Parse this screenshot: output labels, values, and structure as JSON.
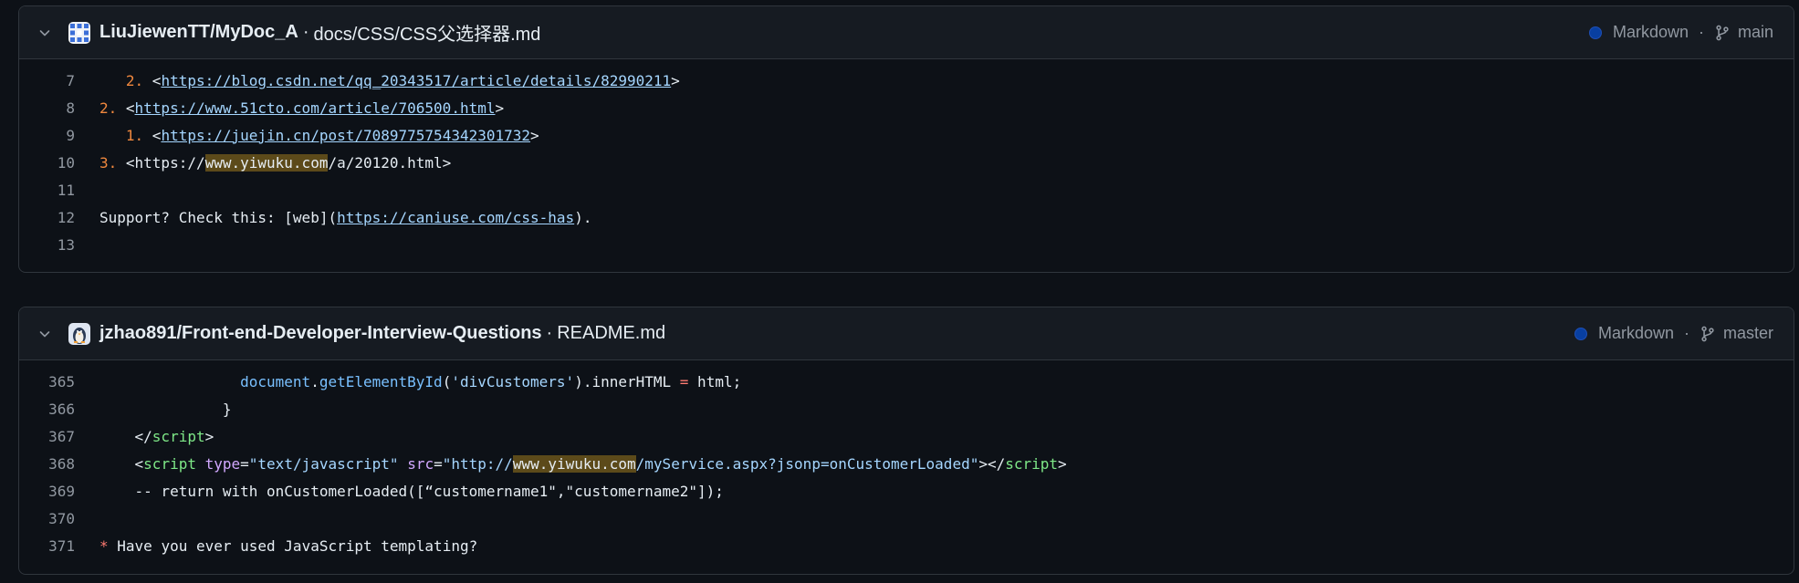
{
  "results": [
    {
      "repo": "LiuJiewenTT/MyDoc_A",
      "separator": "·",
      "path": "docs/CSS/CSS父选择器.md",
      "language": "Markdown",
      "meta_separator": "·",
      "branch": "main",
      "lines": [
        {
          "num": "7",
          "segments": [
            {
              "text": "   "
            },
            {
              "text": "2.",
              "style": "lm"
            },
            {
              "text": " <"
            },
            {
              "text": "https://blog.csdn.net/qq_20343517/article/details/82990211",
              "style": "u"
            },
            {
              "text": ">"
            }
          ]
        },
        {
          "num": "8",
          "segments": [
            {
              "text": "2.",
              "style": "lm"
            },
            {
              "text": " <"
            },
            {
              "text": "https://www.51cto.com/article/706500.html",
              "style": "u"
            },
            {
              "text": ">"
            }
          ]
        },
        {
          "num": "9",
          "segments": [
            {
              "text": "   "
            },
            {
              "text": "1.",
              "style": "lm"
            },
            {
              "text": " <"
            },
            {
              "text": "https://juejin.cn/post/7089775754342301732",
              "style": "u"
            },
            {
              "text": ">"
            }
          ]
        },
        {
          "num": "10",
          "segments": [
            {
              "text": "3.",
              "style": "lm"
            },
            {
              "text": " <https://"
            },
            {
              "text": "www.yiwuku.com",
              "style": "hl"
            },
            {
              "text": "/a/20120.html>"
            }
          ]
        },
        {
          "num": "11",
          "segments": []
        },
        {
          "num": "12",
          "segments": [
            {
              "text": "Support? Check this: [web]("
            },
            {
              "text": "https://caniuse.com/css-has",
              "style": "u"
            },
            {
              "text": ")."
            }
          ]
        },
        {
          "num": "13",
          "segments": []
        }
      ]
    },
    {
      "repo": "jzhao891/Front-end-Developer-Interview-Questions",
      "separator": "·",
      "path": "README.md",
      "language": "Markdown",
      "meta_separator": "·",
      "branch": "master",
      "lines": [
        {
          "num": "365",
          "segments": [
            {
              "text": "                "
            },
            {
              "text": "document",
              "style": "fn"
            },
            {
              "text": "."
            },
            {
              "text": "getElementById",
              "style": "fn"
            },
            {
              "text": "("
            },
            {
              "text": "'divCustomers'",
              "style": "str"
            },
            {
              "text": ").innerHTML "
            },
            {
              "text": "=",
              "style": "op"
            },
            {
              "text": " html;"
            }
          ]
        },
        {
          "num": "366",
          "segments": [
            {
              "text": "              }"
            }
          ]
        },
        {
          "num": "367",
          "segments": [
            {
              "text": "    </"
            },
            {
              "text": "script",
              "style": "tag"
            },
            {
              "text": ">"
            }
          ]
        },
        {
          "num": "368",
          "segments": [
            {
              "text": "    <"
            },
            {
              "text": "script",
              "style": "tag"
            },
            {
              "text": " "
            },
            {
              "text": "type",
              "style": "attr"
            },
            {
              "text": "="
            },
            {
              "text": "\"text/javascript\"",
              "style": "str"
            },
            {
              "text": " "
            },
            {
              "text": "src",
              "style": "attr"
            },
            {
              "text": "="
            },
            {
              "text": "\"http://",
              "style": "str"
            },
            {
              "text": "www.yiwuku.com",
              "style": "hl"
            },
            {
              "text": "/myService.aspx?jsonp=onCustomerLoaded\"",
              "style": "str"
            },
            {
              "text": "></"
            },
            {
              "text": "script",
              "style": "tag"
            },
            {
              "text": ">"
            }
          ]
        },
        {
          "num": "369",
          "segments": [
            {
              "text": "    -- return with onCustomerLoaded([“customername1\",\"customername2\"]);"
            }
          ]
        },
        {
          "num": "370",
          "segments": []
        },
        {
          "num": "371",
          "segments": [
            {
              "text": "*",
              "style": "op"
            },
            {
              "text": " Have you ever used JavaScript templating?"
            }
          ]
        }
      ]
    }
  ]
}
